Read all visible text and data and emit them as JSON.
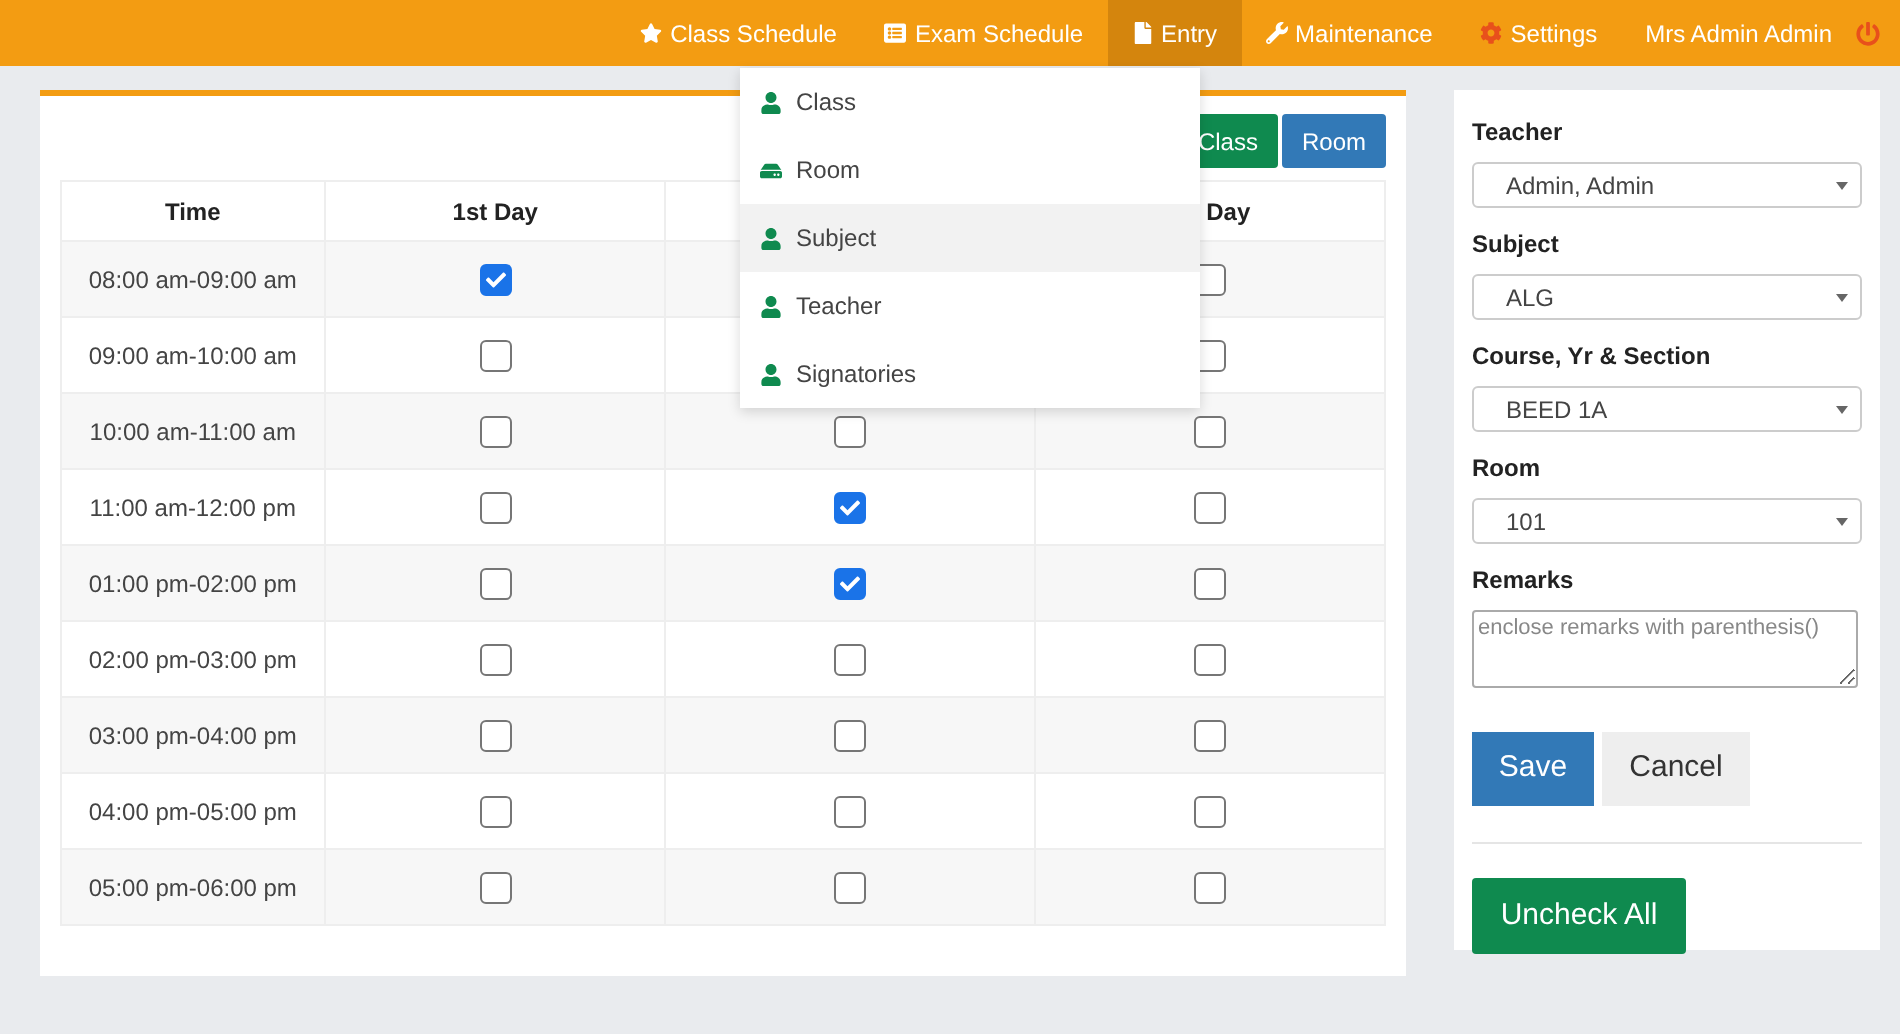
{
  "nav": {
    "items": [
      {
        "label": "Class Schedule",
        "selected": false
      },
      {
        "label": "Exam Schedule",
        "selected": false
      },
      {
        "label": "Entry",
        "selected": true
      },
      {
        "label": "Maintenance",
        "selected": false
      },
      {
        "label": "Settings",
        "selected": false
      },
      {
        "label": "Mrs Admin Admin",
        "selected": false
      }
    ]
  },
  "entry_menu": {
    "items": [
      {
        "label": "Class",
        "selected": false
      },
      {
        "label": "Room",
        "selected": false
      },
      {
        "label": "Subject",
        "selected": true
      },
      {
        "label": "Teacher",
        "selected": false
      },
      {
        "label": "Signatories",
        "selected": false
      }
    ]
  },
  "top_buttons": [
    {
      "label": "Class",
      "kind": "success"
    },
    {
      "label": "Room",
      "kind": "primary"
    }
  ],
  "table": {
    "columns": [
      "Time",
      "1st Day",
      "",
      "Day"
    ],
    "rows": [
      {
        "time": "08:00 am-09:00 am",
        "day_1": {
          "checked": true
        },
        "day_3": {
          "checked": false
        }
      },
      {
        "time": "09:00 am-10:00 am",
        "day_1": {
          "checked": false
        },
        "day_3": {
          "checked": false
        }
      },
      {
        "time": "10:00 am-11:00 am",
        "day_1": {
          "checked": false
        },
        "day_2": {
          "checked": false
        },
        "day_3": {
          "checked": false
        }
      },
      {
        "time": "11:00 am-12:00 pm",
        "day_1": {
          "checked": false
        },
        "day_2": {
          "checked": true
        },
        "day_3": {
          "checked": false
        }
      },
      {
        "time": "01:00 pm-02:00 pm",
        "day_1": {
          "checked": false
        },
        "day_2": {
          "checked": true
        },
        "day_3": {
          "checked": false
        }
      },
      {
        "time": "02:00 pm-03:00 pm",
        "day_1": {
          "checked": false
        },
        "day_2": {
          "checked": false
        },
        "day_3": {
          "checked": false
        }
      },
      {
        "time": "03:00 pm-04:00 pm",
        "day_1": {
          "checked": false
        },
        "day_2": {
          "checked": false
        },
        "day_3": {
          "checked": false
        }
      },
      {
        "time": "04:00 pm-05:00 pm",
        "day_1": {
          "checked": false
        },
        "day_2": {
          "checked": false
        },
        "day_3": {
          "checked": false
        }
      },
      {
        "time": "05:00 pm-06:00 pm",
        "day_1": {
          "checked": false
        },
        "day_2": {
          "checked": false
        },
        "day_3": {
          "checked": false
        }
      }
    ]
  },
  "form": {
    "selects": [
      {
        "label": "Teacher",
        "value": "Admin, Admin"
      },
      {
        "label": "Subject",
        "value": "ALG"
      },
      {
        "label": "Course, Yr & Section",
        "value": "BEED 1A"
      },
      {
        "label": "Room",
        "value": "101"
      }
    ],
    "remarks": {
      "label": "Remarks",
      "placeholder": "enclose remarks with parenthesis()"
    },
    "save": "Save",
    "cancel": "Cancel",
    "uncheck_all": "Uncheck All"
  }
}
